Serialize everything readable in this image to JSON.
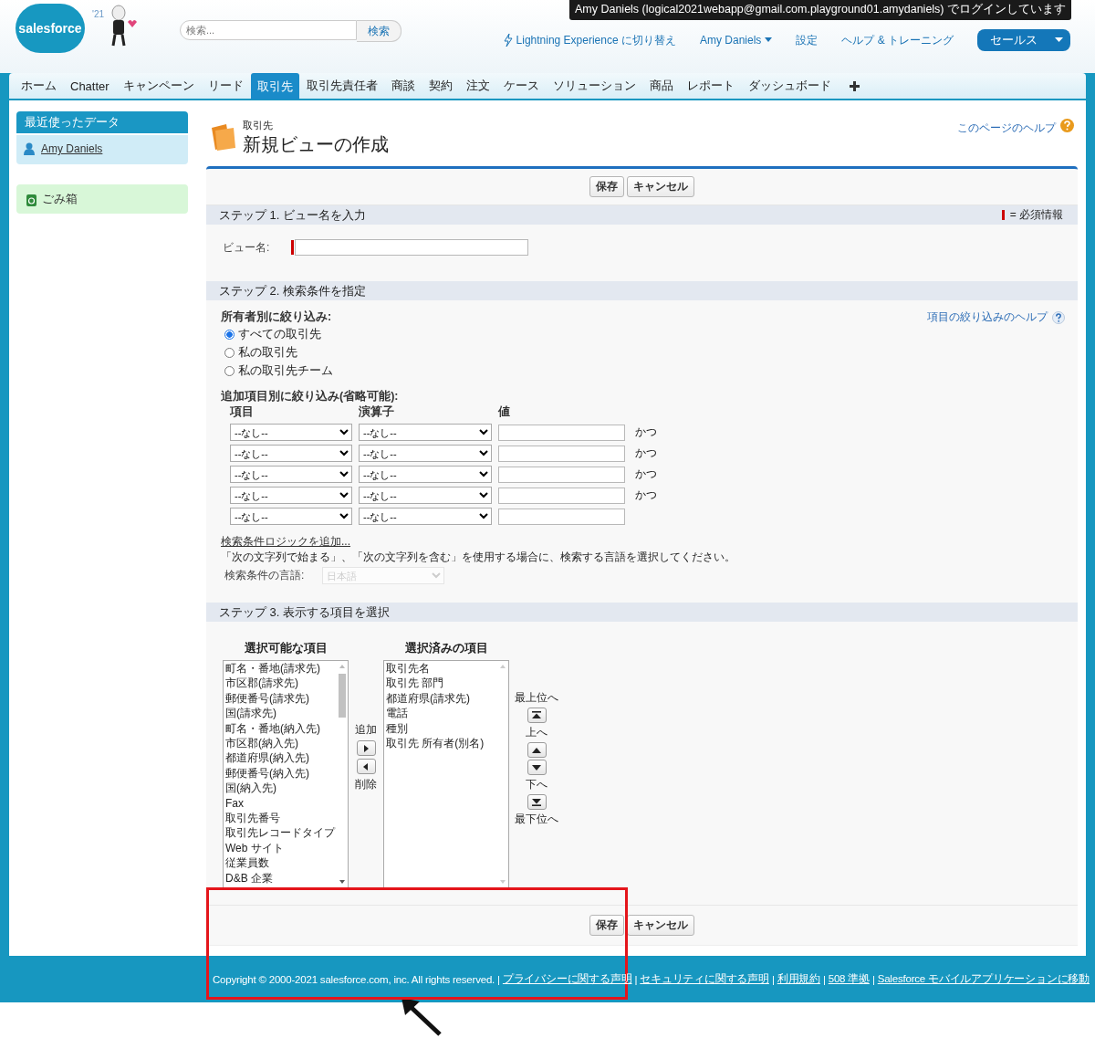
{
  "header": {
    "logo": "salesforce",
    "logo_badge": "'21",
    "search": {
      "placeholder": "検索..."
    },
    "search_button": "検索",
    "login_notice": "Amy Daniels (logical2021webapp@gmail.com.playground01.amydaniels) でログインしています",
    "links": [
      {
        "label": "Lightning Experience に切り替え",
        "kind": "lightning"
      },
      {
        "label": "Amy Daniels",
        "kind": "menu"
      },
      {
        "label": "設定",
        "kind": "plain"
      },
      {
        "label": "ヘルプ & トレーニング",
        "kind": "plain"
      }
    ],
    "app_menu": "セールス"
  },
  "tabs": [
    {
      "label": "ホーム",
      "selected": false
    },
    {
      "label": "Chatter",
      "selected": false
    },
    {
      "label": "キャンペーン",
      "selected": false
    },
    {
      "label": "リード",
      "selected": false
    },
    {
      "label": "取引先",
      "selected": true
    },
    {
      "label": "取引先責任者",
      "selected": false
    },
    {
      "label": "商談",
      "selected": false
    },
    {
      "label": "契約",
      "selected": false
    },
    {
      "label": "注文",
      "selected": false
    },
    {
      "label": "ケース",
      "selected": false
    },
    {
      "label": "ソリューション",
      "selected": false
    },
    {
      "label": "商品",
      "selected": false
    },
    {
      "label": "レポート",
      "selected": false
    },
    {
      "label": "ダッシュボード",
      "selected": false
    }
  ],
  "sidebar": {
    "recent_title": "最近使ったデータ",
    "recent_items": [
      "Amy Daniels"
    ],
    "recycle_bin": "ごみ箱"
  },
  "page": {
    "object_label": "取引先",
    "title": "新規ビューの作成",
    "help_link": "このページのヘルプ"
  },
  "top_buttons": [
    "保存",
    "キャンセル"
  ],
  "step1": {
    "title": "ステップ 1. ビュー名を入力",
    "required_legend": "= 必須情報",
    "view_name_label": "ビュー名:"
  },
  "step2": {
    "title": "ステップ 2. 検索条件を指定",
    "help_link": "項目の絞り込みのヘルプ",
    "owner_label": "所有者別に絞り込み:",
    "owner_options": [
      {
        "label": "すべての取引先",
        "selected": true
      },
      {
        "label": "私の取引先",
        "selected": false
      },
      {
        "label": "私の取引先チーム",
        "selected": false
      }
    ],
    "filter_label": "追加項目別に絞り込み(省略可能):",
    "columns": [
      "項目",
      "演算子",
      "値"
    ],
    "filters": [
      {
        "field": "--なし--",
        "operator": "--なし--",
        "conjunction": "かつ"
      },
      {
        "field": "--なし--",
        "operator": "--なし--",
        "conjunction": "かつ"
      },
      {
        "field": "--なし--",
        "operator": "--なし--",
        "conjunction": "かつ"
      },
      {
        "field": "--なし--",
        "operator": "--なし--",
        "conjunction": "かつ"
      },
      {
        "field": "--なし--",
        "operator": "--なし--"
      }
    ],
    "logic_link": "検索条件ロジックを追加...",
    "language_note": "「次の文字列で始まる」、「次の文字列を含む」を使用する場合に、検索する言語を選択してください。",
    "language_label": "検索条件の言語:",
    "language_value": "日本語",
    "language_disabled": true
  },
  "step3": {
    "title": "ステップ 3. 表示する項目を選択",
    "available_title": "選択可能な項目",
    "available": [
      "町名・番地(請求先)",
      "市区郡(請求先)",
      "郵便番号(請求先)",
      "国(請求先)",
      "町名・番地(納入先)",
      "市区郡(納入先)",
      "都道府県(納入先)",
      "郵便番号(納入先)",
      "国(納入先)",
      "Fax",
      "取引先番号",
      "取引先レコードタイプ",
      "Web サイト",
      "従業員数",
      "D&B 企業"
    ],
    "selected_title": "選択済みの項目",
    "selected_fields": [
      "取引先名",
      "取引先 部門",
      "都道府県(請求先)",
      "電話",
      "種別",
      "取引先 所有者(別名)"
    ],
    "add_label": "追加",
    "remove_label": "削除",
    "order_controls": [
      {
        "kind": "label",
        "text": "最上位へ"
      },
      {
        "kind": "top-button"
      },
      {
        "kind": "label",
        "text": "上へ"
      },
      {
        "kind": "up-button"
      },
      {
        "kind": "down-button"
      },
      {
        "kind": "label",
        "text": "下へ"
      },
      {
        "kind": "bottom-button"
      },
      {
        "kind": "label",
        "text": "最下位へ"
      }
    ]
  },
  "bottom_buttons": [
    "保存",
    "キャンセル"
  ],
  "footer": {
    "copyright": "Copyright © 2000-2021 salesforce.com, inc. All rights reserved.",
    "separator": "|",
    "links": [
      "プライバシーに関する声明",
      "セキュリティに関する声明",
      "利用規約",
      "508 準拠",
      "Salesforce モバイルアプリケーションに移動"
    ]
  }
}
